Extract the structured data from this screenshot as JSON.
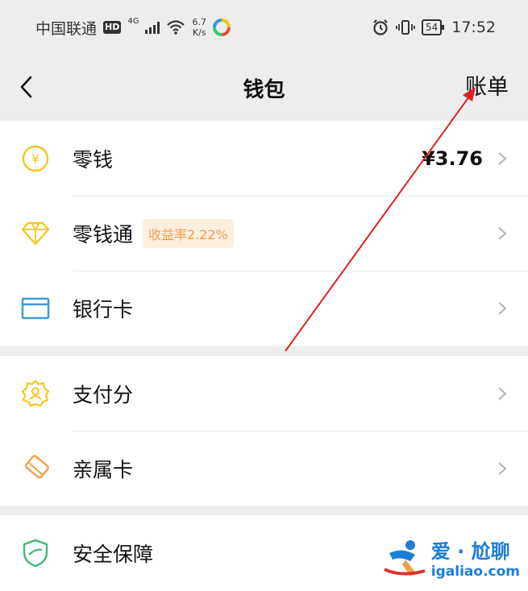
{
  "status_bar": {
    "carrier": "中国联通",
    "hd": "HD",
    "network": "4G",
    "speed_value": "6.7",
    "speed_unit": "K/s",
    "battery": "54",
    "time": "17:52"
  },
  "nav": {
    "title": "钱包",
    "bill": "账单"
  },
  "groups": [
    {
      "items": [
        {
          "label": "零钱",
          "value": "¥3.76",
          "icon": "coin-icon"
        },
        {
          "label": "零钱通",
          "badge": "收益率2.22%",
          "icon": "diamond-icon"
        },
        {
          "label": "银行卡",
          "icon": "card-icon"
        }
      ]
    },
    {
      "items": [
        {
          "label": "支付分",
          "icon": "badge-icon"
        },
        {
          "label": "亲属卡",
          "icon": "family-card-icon"
        }
      ]
    },
    {
      "items": [
        {
          "label": "安全保障",
          "icon": "shield-icon"
        }
      ]
    }
  ],
  "watermark": {
    "line1": "爱 · 尬聊",
    "line2": "igaliao.com"
  },
  "colors": {
    "icon_yellow": "#f3c623",
    "icon_blue": "#3b9ad9",
    "icon_orange": "#f0a04b",
    "icon_green": "#3cb878",
    "badge_bg": "#fdeede",
    "badge_text": "#f0a04b",
    "annotation_arrow": "#e02020",
    "watermark": "#1c7ed6"
  }
}
